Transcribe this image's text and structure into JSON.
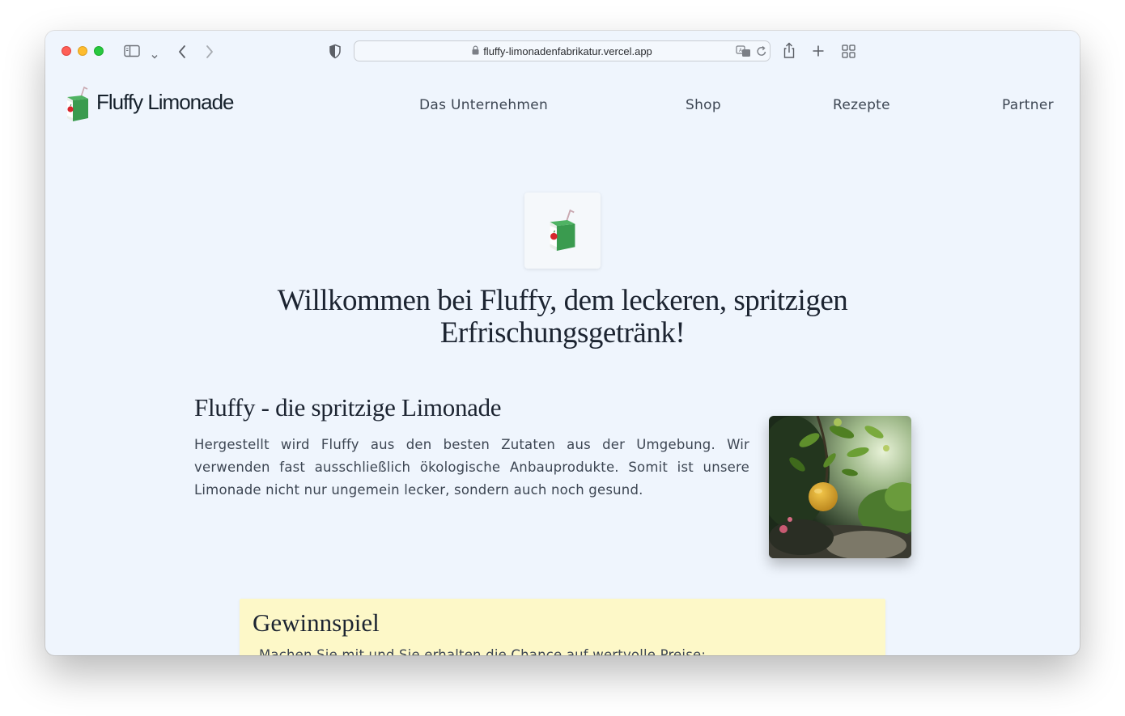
{
  "browser": {
    "url": "fluffy-limonadenfabrikatur.vercel.app",
    "icons": [
      "sidebar-icon",
      "chevron-down-icon",
      "back-icon",
      "forward-icon",
      "privacy-shield-icon",
      "lock-icon",
      "translate-icon",
      "reload-icon",
      "share-icon",
      "new-tab-icon",
      "tab-overview-icon"
    ]
  },
  "site": {
    "brand": "Fluffy Limonade",
    "nav": {
      "company": "Das Unternehmen",
      "shop": "Shop",
      "recipes": "Rezepte",
      "partner": "Partner"
    },
    "hero_title": "Willkommen bei Fluffy, dem leckeren, spritzigen Erfrischungsgetränk!",
    "section": {
      "title": "Fluffy - die spritzige Limonade",
      "text": "Hergestellt wird Fluffy aus den besten Zutaten aus der Umgebung. Wir verwenden fast ausschließlich ökologische Anbauprodukte. Somit ist unsere Limonade nicht nur ungemein lecker, sondern auch noch gesund."
    },
    "contest": {
      "title": "Gewinnspiel",
      "text": "Machen Sie mit und Sie erhalten die Chance auf wertvolle Preise:"
    }
  },
  "colors": {
    "page_bg": "#eff5fd",
    "heading": "#1c2431",
    "text": "#3d4653",
    "contest_bg": "#fdf8c8",
    "carton_green": "#3a9b4f",
    "apple_red": "#d8262d"
  }
}
